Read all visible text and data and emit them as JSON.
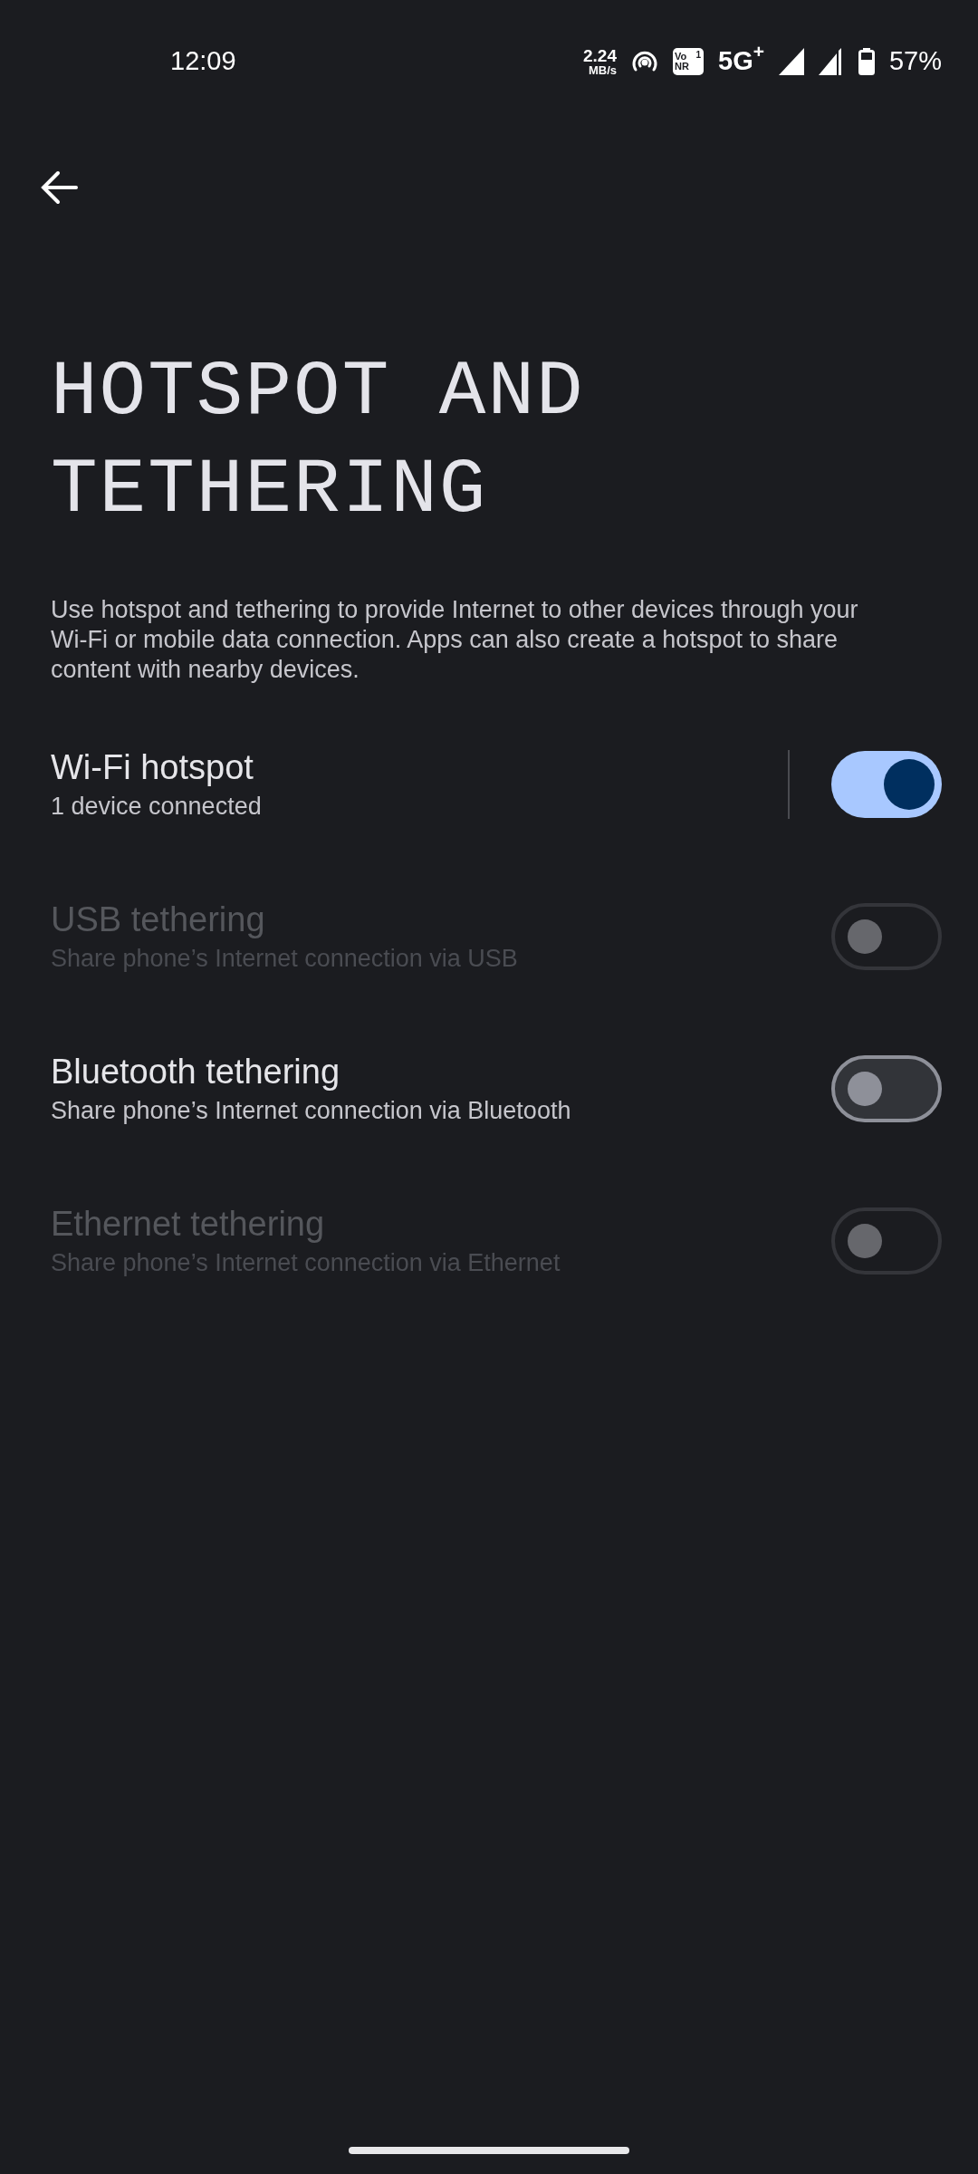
{
  "status_bar": {
    "time": "12:09",
    "speed_value": "2.24",
    "speed_unit": "MB/s",
    "volte_top": "Vo",
    "volte_bottom": "NR",
    "sim_slot": "1",
    "network": "5G",
    "network_plus": "+",
    "battery": "57%"
  },
  "title": "HOTSPOT AND TETHERING",
  "description": "Use hotspot and tethering to provide Internet to other devices through your Wi-Fi or mobile data connection. Apps can also create a hotspot to share content with nearby devices.",
  "items": [
    {
      "title": "Wi-Fi hotspot",
      "subtitle": "1 device connected",
      "on": true,
      "disabled": false,
      "divider": true
    },
    {
      "title": "USB tethering",
      "subtitle": "Share phone’s Internet connection via USB",
      "on": false,
      "disabled": true,
      "divider": false
    },
    {
      "title": "Bluetooth tethering",
      "subtitle": "Share phone’s Internet connection via Bluetooth",
      "on": false,
      "disabled": false,
      "divider": false
    },
    {
      "title": "Ethernet tethering",
      "subtitle": "Share phone’s Internet connection via Ethernet",
      "on": false,
      "disabled": true,
      "divider": false
    }
  ]
}
